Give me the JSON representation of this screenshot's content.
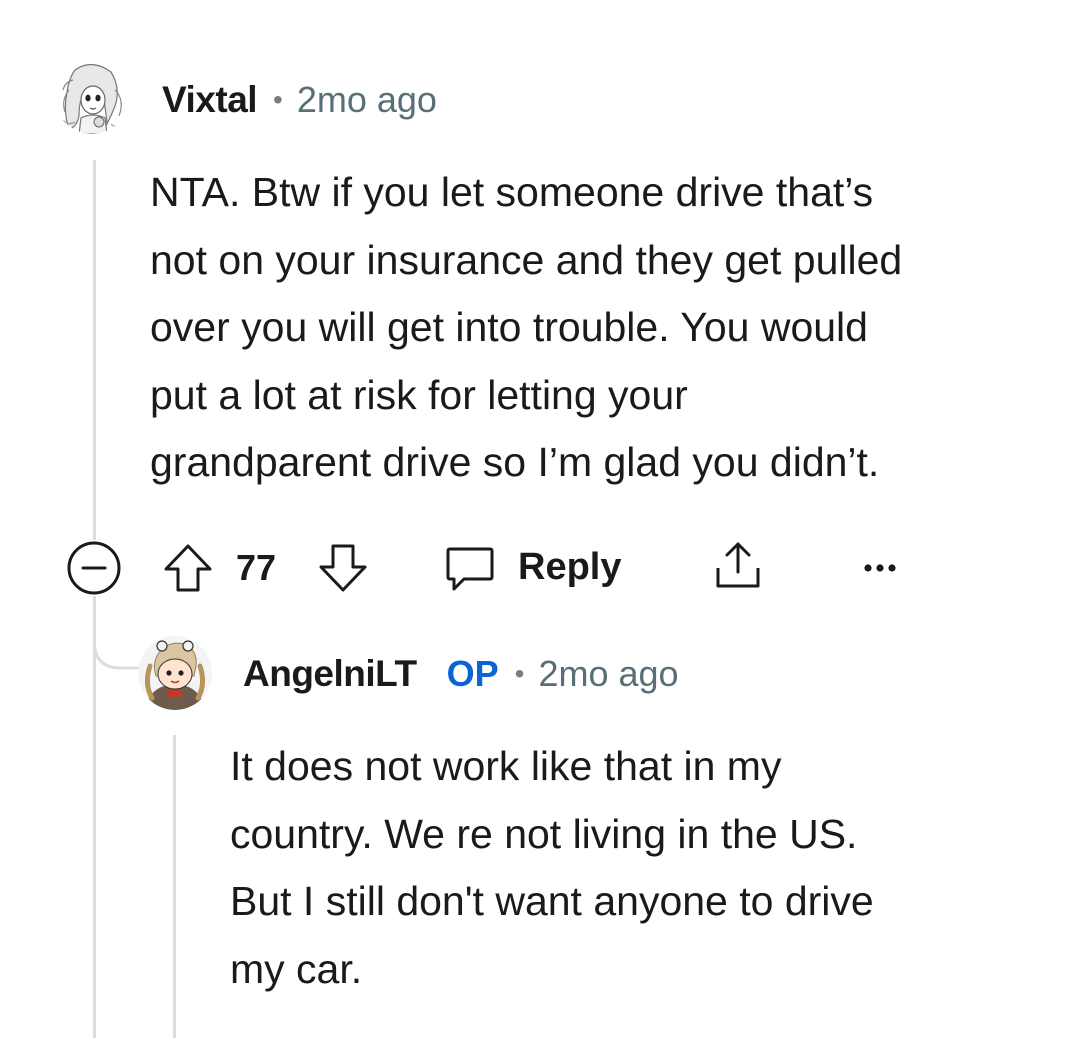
{
  "comment": {
    "avatar_icon": "anime-girl-sketch-avatar",
    "username": "Vixtal",
    "timestamp": "2mo ago",
    "body_lines": [
      "NTA. Btw if you let someone drive that’s",
      "not on your insurance and they get pulled",
      "over you will get into trouble. You would",
      "put a lot at risk for letting your",
      "grandparent drive so I’m glad you didn’t."
    ],
    "actions": {
      "collapse_icon": "minus-circle-icon",
      "upvote_icon": "arrow-up-icon",
      "vote_count": "77",
      "downvote_icon": "arrow-down-icon",
      "reply_icon": "speech-bubble-icon",
      "reply_label": "Reply",
      "share_icon": "share-icon",
      "more_icon": "more-options-icon"
    }
  },
  "reply": {
    "avatar_icon": "snoo-avatar",
    "username": "AngelniLT",
    "op_badge": "OP",
    "timestamp": "2mo ago",
    "body_lines": [
      "It does not work like that in my",
      "country. We re not living in the US.",
      "But I still don't want anyone to drive",
      "my car."
    ]
  },
  "colors": {
    "op_badge": "#0a64d6",
    "timestamp": "#576f76",
    "thread_line": "#dcdcdc",
    "text": "#1a1a1b"
  }
}
